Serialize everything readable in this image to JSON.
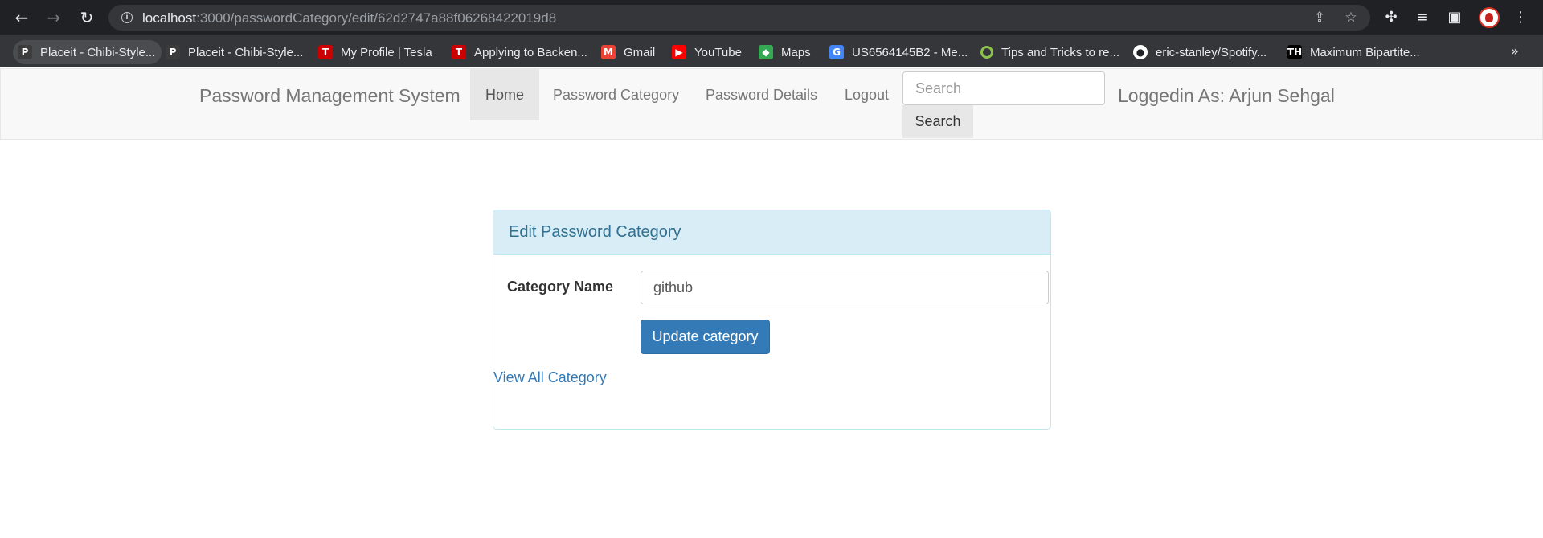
{
  "browser": {
    "url_host": "localhost",
    "url_rest": ":3000/passwordCategory/edit/62d2747a88f06268422019d8",
    "bookmarks": [
      {
        "label": "Placeit - Chibi-Style...",
        "icon": "placeit-icon",
        "color": "#3c3c3c"
      },
      {
        "label": "Placeit - Chibi-Style...",
        "icon": "placeit-icon",
        "color": "#3c3c3c"
      },
      {
        "label": "My Profile | Tesla",
        "icon": "tesla-icon",
        "color": "#cc0000"
      },
      {
        "label": "Applying to Backen...",
        "icon": "tesla-icon",
        "color": "#cc0000"
      },
      {
        "label": "Gmail",
        "icon": "gmail-icon",
        "color": "#ea4335"
      },
      {
        "label": "YouTube",
        "icon": "youtube-icon",
        "color": "#ff0000"
      },
      {
        "label": "Maps",
        "icon": "maps-icon",
        "color": "#34a853"
      },
      {
        "label": "US6564145B2 - Me...",
        "icon": "google-icon",
        "color": "#4285f4"
      },
      {
        "label": "Tips and Tricks to re...",
        "icon": "ring-icon",
        "color": "#8bc34a"
      },
      {
        "label": "eric-stanley/Spotify...",
        "icon": "github-icon",
        "color": "#ffffff"
      },
      {
        "label": "Maximum Bipartite...",
        "icon": "th-icon",
        "color": "#000000"
      }
    ],
    "more_label": "»"
  },
  "navbar": {
    "brand": "Password Management System",
    "links": [
      "Home",
      "Password Category",
      "Password Details",
      "Logout"
    ],
    "active_link": "Home",
    "search_placeholder": "Search",
    "search_button": "Search",
    "logged_in": "Loggedin As: Arjun Sehgal"
  },
  "panel": {
    "heading": "Edit Password Category",
    "field_label": "Category Name",
    "field_value": "github",
    "submit_label": "Update category",
    "view_all_label": "View All Category"
  },
  "colors": {
    "primary": "#337ab7",
    "panel_heading_bg": "#d9edf7",
    "panel_heading_text": "#31708f",
    "chrome_dark": "#202124"
  }
}
